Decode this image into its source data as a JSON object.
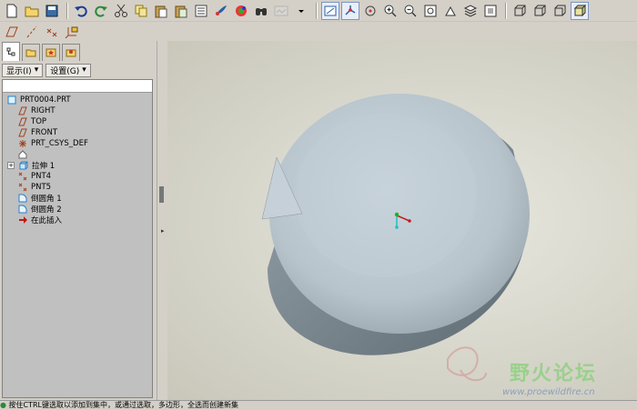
{
  "toolbar": {
    "row1_icons": [
      "new-file-icon",
      "open-folder-icon",
      "save-icon",
      "undo-icon",
      "redo-icon",
      "cut-icon",
      "copy-icon",
      "paste-icon",
      "paste-special-icon",
      "regenerate-icon",
      "repaint-icon",
      "model-tree-icon",
      "view-manager-icon",
      "find-icon",
      "unknown-disabled-icon",
      "dropdown-arrow-icon",
      "saved-view-icon",
      "datum-display-icon",
      "spin-center-icon",
      "zoom-in-icon",
      "zoom-out-icon",
      "refit-icon",
      "orient-icon",
      "layers-icon",
      "view-orient-icon",
      "wireframe-icon",
      "hidden-line-icon",
      "no-hidden-icon",
      "shading-icon"
    ],
    "row2_icons": [
      "datum-plane-toggle-icon",
      "datum-axis-toggle-icon",
      "datum-point-toggle-icon",
      "coord-sys-toggle-icon"
    ]
  },
  "panel": {
    "tabs": [
      "model-tree-tab",
      "folder-browser-tab",
      "favorites-tab",
      "connections-tab"
    ],
    "show_menu": "显示(I)",
    "settings_menu": "设置(G)"
  },
  "tree": {
    "items": [
      {
        "label": "PRT0004.PRT",
        "icon": "part-icon"
      },
      {
        "label": "RIGHT",
        "icon": "datum-plane-icon"
      },
      {
        "label": "TOP",
        "icon": "datum-plane-icon"
      },
      {
        "label": "FRONT",
        "icon": "datum-plane-icon"
      },
      {
        "label": "PRT_CSYS_DEF",
        "icon": "coordinate-system-icon"
      },
      {
        "label": "",
        "icon": "revolve-feature-icon"
      },
      {
        "label": "拉伸 1",
        "icon": "extrude-icon"
      },
      {
        "label": "PNT4",
        "icon": "datum-point-icon"
      },
      {
        "label": "PNT5",
        "icon": "datum-point-icon"
      },
      {
        "label": "倒圆角 1",
        "icon": "round-icon"
      },
      {
        "label": "倒圆角 2",
        "icon": "round-icon"
      },
      {
        "label": "在此插入",
        "icon": "insert-here-arrow-icon"
      }
    ]
  },
  "status": {
    "message": "按住CTRL键选取以添加到集中，或通过选取，多边形，全选而创建新集"
  },
  "watermark": {
    "title": "野火论坛",
    "url": "www.proewildfire.cn"
  },
  "colors": {
    "background": "#d4d0c8",
    "viewport": "#d7d6cb",
    "model": "#b9c4cc",
    "tree": "#c0c0c0"
  }
}
